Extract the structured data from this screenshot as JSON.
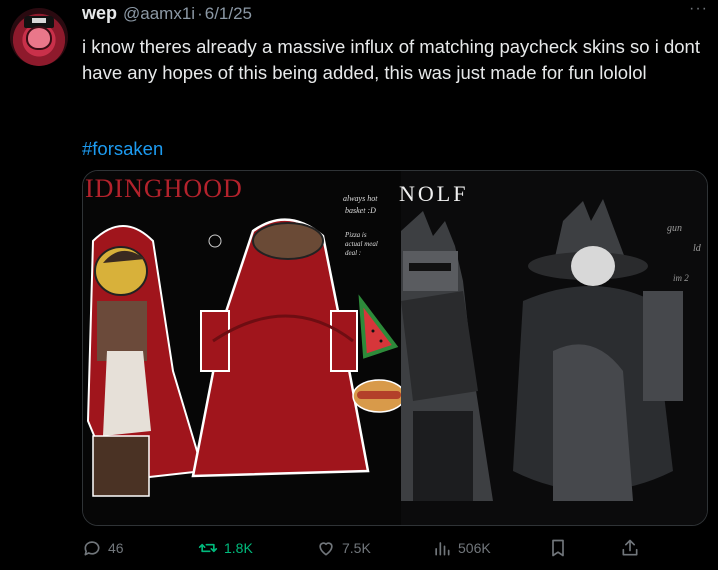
{
  "post": {
    "author_name": "wep",
    "author_handle": "@aamx1i",
    "separator": "·",
    "date": "6/1/25",
    "text": "i know theres already a massive influx of matching paycheck skins so i dont have any hopes of this being added, this was just made for fun lololol",
    "hashtag": "#forsaken",
    "more_icon": "more-icon",
    "more_glyph": "···"
  },
  "media": {
    "title_left": "IDINGHOOD",
    "title_right": "NOLF",
    "note_always": "always hot",
    "note_basket": "basket :D",
    "note_pizza": "Pizza is",
    "note_actual": "actual meal",
    "note_deal": "deal :",
    "note_right1": "gun",
    "note_right2": "ld",
    "note_right3": "im 2",
    "colors": {
      "hood_red": "#a0151c",
      "hood_dark": "#6e0d12",
      "wolf_gray": "#3d3f42",
      "wolf_dark": "#1c1d1f"
    }
  },
  "actions": {
    "replies": "46",
    "reposts": "1.8K",
    "likes": "7.5K",
    "views": "506K"
  },
  "accent": "#1d9bf0",
  "repost_color": "#00ba7c"
}
